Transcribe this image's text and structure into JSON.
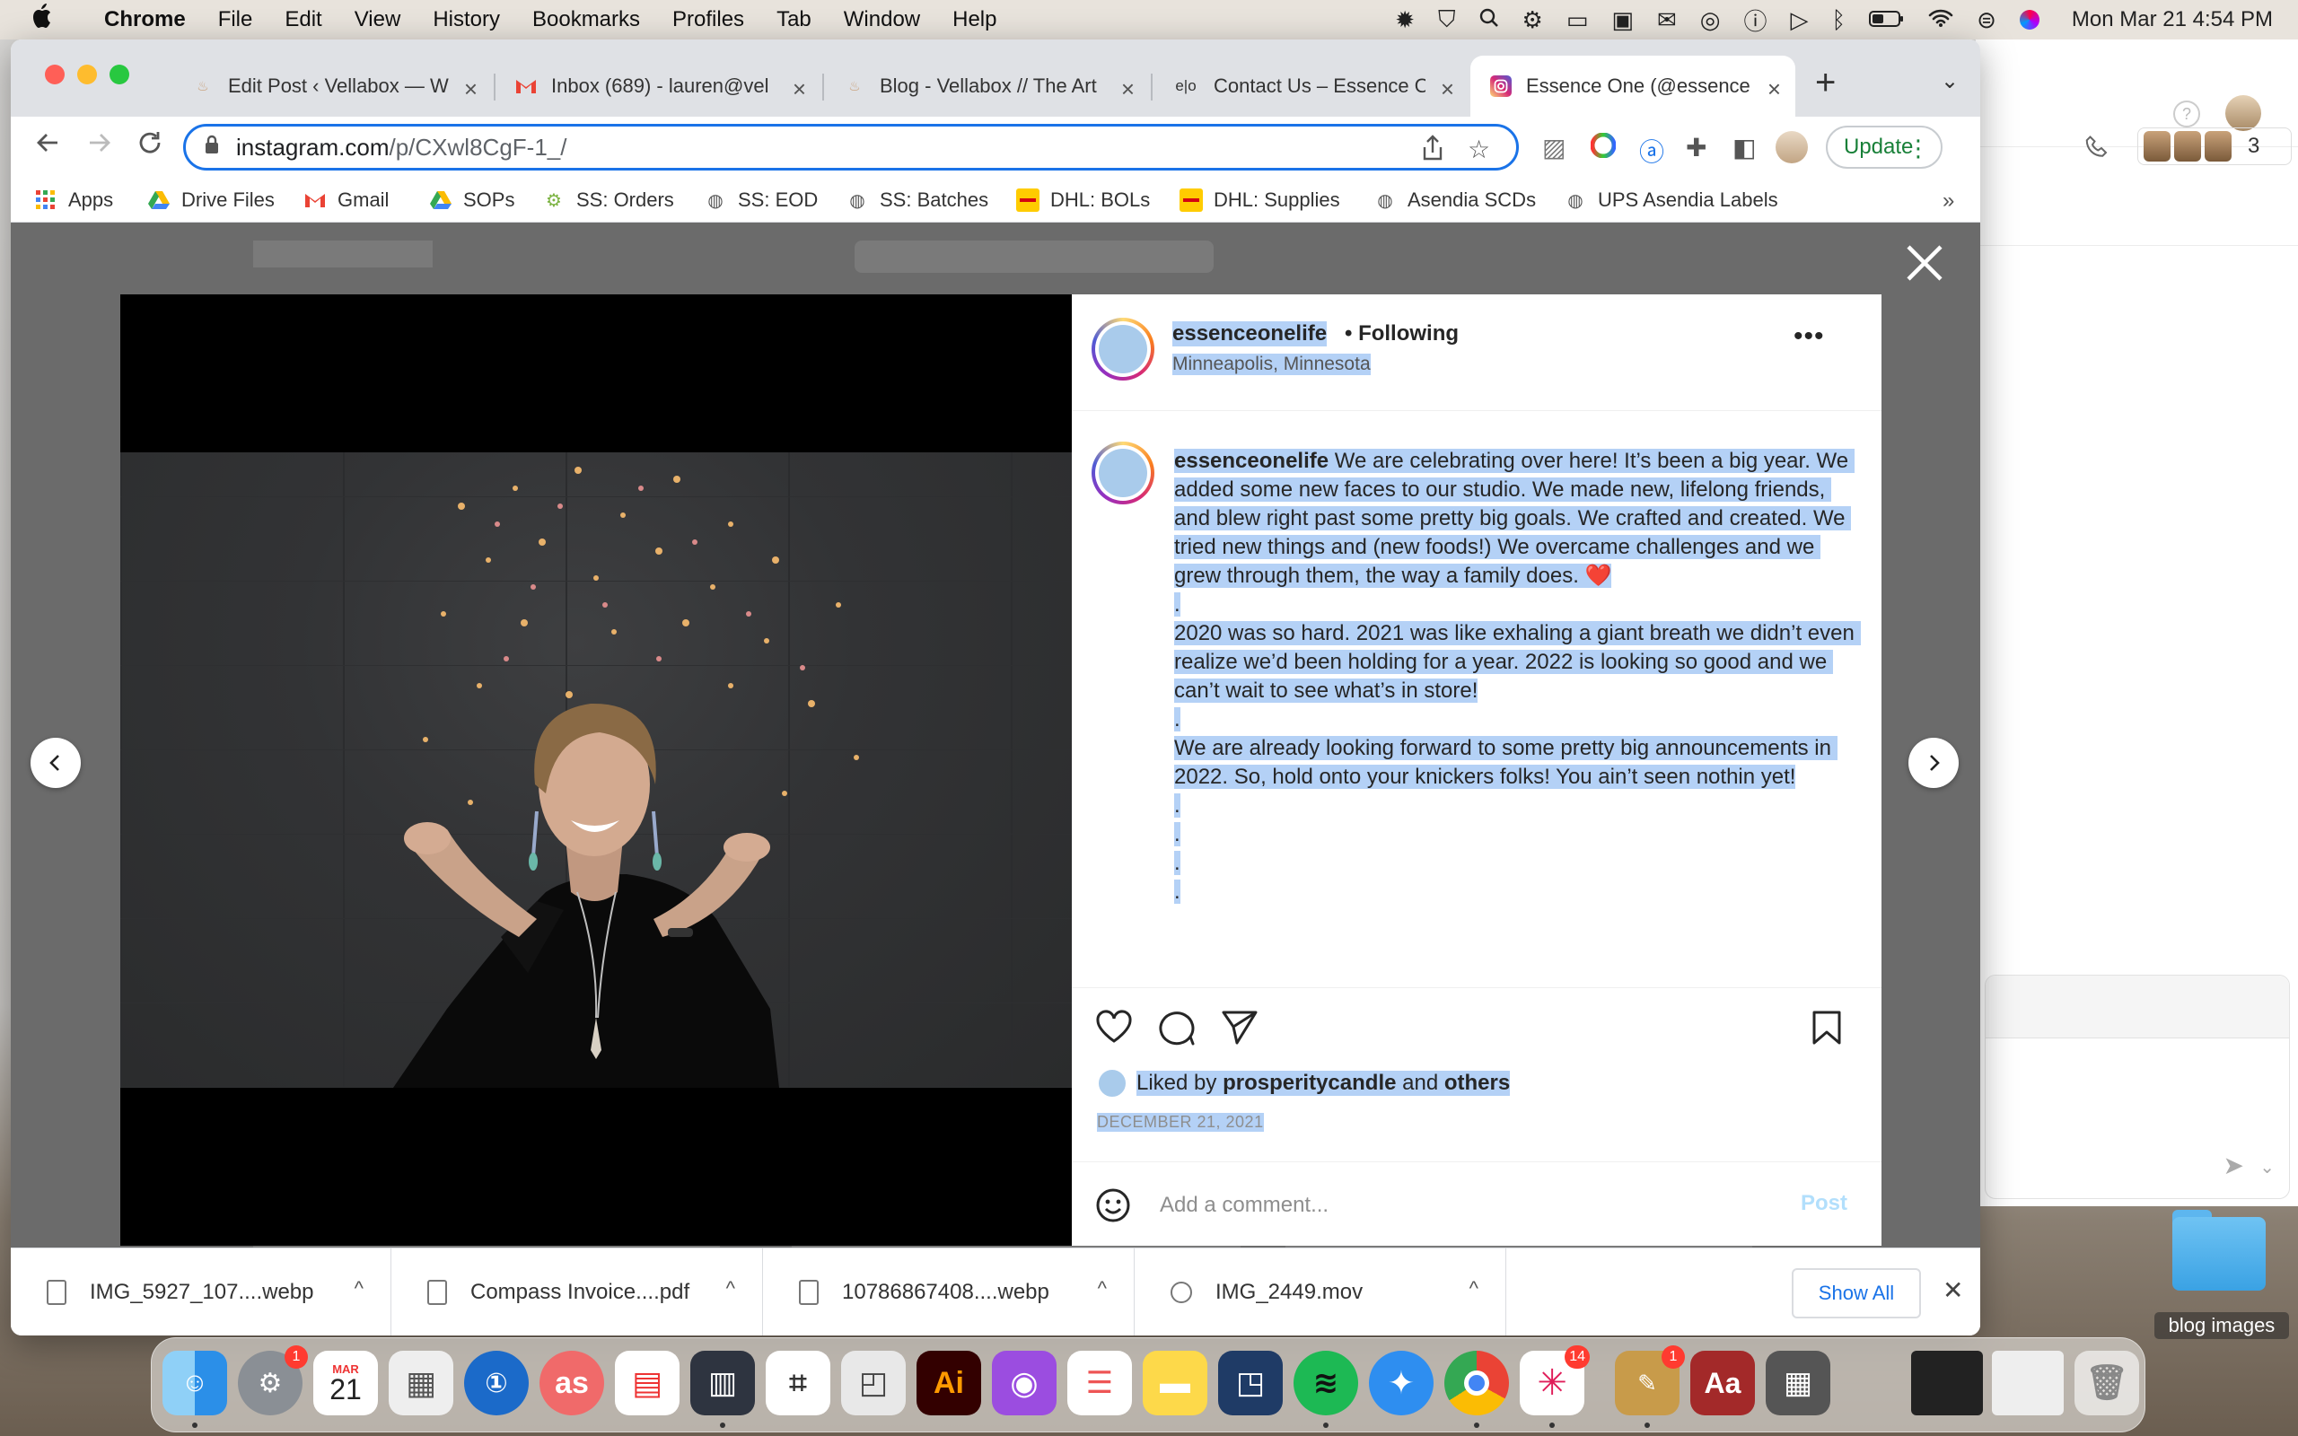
{
  "menubar": {
    "app": "Chrome",
    "items": [
      "File",
      "Edit",
      "View",
      "History",
      "Bookmarks",
      "Profiles",
      "Tab",
      "Window",
      "Help"
    ],
    "clock": "Mon Mar 21  4:54 PM"
  },
  "tabs": [
    {
      "title": "Edit Post ‹ Vellabox — W",
      "icon": "flame-icon"
    },
    {
      "title": "Inbox (689) - lauren@vel",
      "icon": "gmail-icon"
    },
    {
      "title": "Blog - Vellabox // The Art",
      "icon": "flame-icon"
    },
    {
      "title": "Contact Us – Essence O",
      "icon": "essence-icon",
      "icon_text": "e|o"
    },
    {
      "title": "Essence One (@essence",
      "icon": "instagram-icon",
      "active": true
    }
  ],
  "omnibox": {
    "host": "instagram.com",
    "path": "/p/CXwl8CgF-1_/"
  },
  "update_label": "Update",
  "bookmarks": [
    {
      "label": "Apps",
      "icon": "apps-grid-icon"
    },
    {
      "label": "Drive Files",
      "icon": "drive-icon"
    },
    {
      "label": "Gmail",
      "icon": "gmail-icon"
    },
    {
      "label": "SOPs",
      "icon": "drive-icon"
    },
    {
      "label": "SS: Orders",
      "icon": "gear-icon"
    },
    {
      "label": "SS: EOD",
      "icon": "globe-icon"
    },
    {
      "label": "SS: Batches",
      "icon": "globe-icon"
    },
    {
      "label": "DHL: BOLs",
      "icon": "dhl-icon"
    },
    {
      "label": "DHL: Supplies",
      "icon": "dhl-icon"
    },
    {
      "label": "Asendia SCDs",
      "icon": "globe-icon"
    },
    {
      "label": "UPS Asendia Labels",
      "icon": "globe-icon"
    }
  ],
  "bookmarks_more": "»",
  "post": {
    "username": "essenceonelife",
    "following": "• Following",
    "location": "Minneapolis, Minnesota",
    "caption_lines": [
      "We are celebrating over here! It’s been a big year. We added some new faces to our studio. We made new, lifelong friends, and blew right past some pretty big goals. We crafted and created. We tried new things and (new foods!) We overcame challenges and we grew through them, the way a family does. ❤️",
      ".",
      "2020 was so hard. 2021 was like exhaling a giant breath we didn’t even realize we’d been holding for a year. 2022 is looking so good and we can’t wait to see what’s in store!",
      ".",
      "We are already looking forward to some pretty big announcements in 2022. So, hold onto your knickers folks! You ain’t seen nothin yet!",
      ".",
      ".",
      ".",
      "."
    ],
    "liked_prefix": "Liked by",
    "liked_user": "prosperitycandle",
    "liked_and": "and",
    "liked_others": "others",
    "date": "DECEMBER 21, 2021",
    "comment_placeholder": "Add a comment...",
    "post_label": "Post"
  },
  "downloads": [
    {
      "name": "IMG_5927_107....webp"
    },
    {
      "name": "Compass Invoice....pdf"
    },
    {
      "name": "10786867408....webp"
    },
    {
      "name": "IMG_2449.mov"
    }
  ],
  "show_all": "Show All",
  "background_app": {
    "avatar_count": "3"
  },
  "desktop_folder": "blog images",
  "dock": {
    "calendar_month": "MAR",
    "calendar_day": "21",
    "badges": {
      "system_prefs": "1",
      "slack": "14",
      "todo": "1"
    },
    "ai_label": "Ai",
    "as_label": "as",
    "aa_label": "Aa"
  },
  "colors": {
    "accent": "#1a73e8",
    "selection": "#b4d1f6",
    "update_green": "#188038",
    "ig_link": "#b2dffc"
  }
}
